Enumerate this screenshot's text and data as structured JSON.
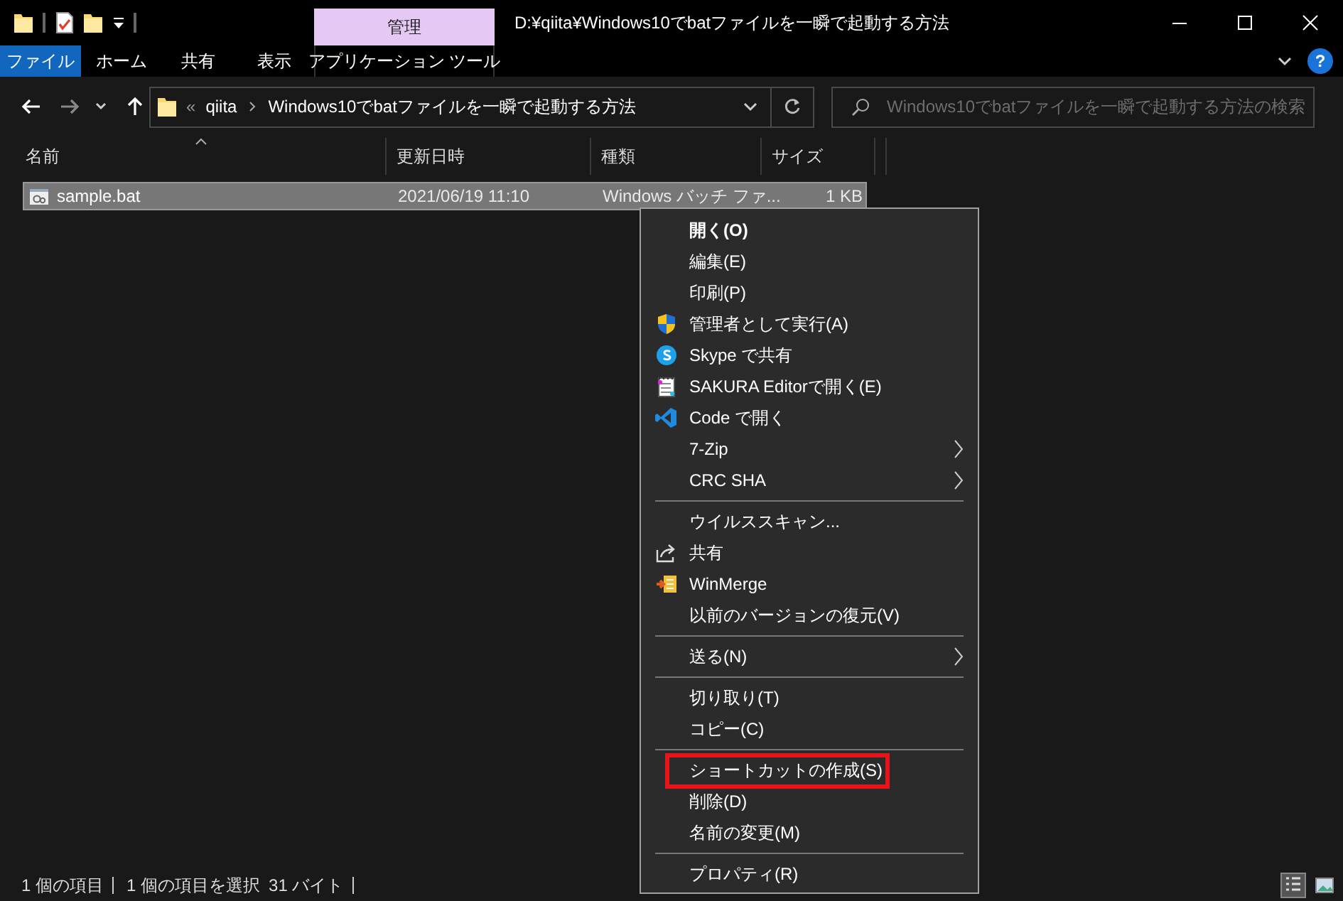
{
  "window": {
    "title": "D:¥qiita¥Windows10でbatファイルを一瞬で起動する方法"
  },
  "ribbon": {
    "tabs": [
      {
        "label": "ファイル",
        "kind": "file",
        "selected": false
      },
      {
        "label": "ホーム",
        "kind": "tab",
        "selected": false
      },
      {
        "label": "共有",
        "kind": "tab",
        "selected": false
      },
      {
        "label": "表示",
        "kind": "tab",
        "selected": false
      }
    ],
    "contextual": {
      "header": "管理",
      "tab": "アプリケーション ツール"
    },
    "help": "?"
  },
  "address": {
    "overflow": "«",
    "crumbs": [
      "qiita",
      "Windows10でbatファイルを一瞬で起動する方法"
    ]
  },
  "search": {
    "placeholder": "Windows10でbatファイルを一瞬で起動する方法の検索"
  },
  "table": {
    "columns": [
      "名前",
      "更新日時",
      "種類",
      "サイズ"
    ],
    "rows": [
      {
        "cells": [
          "sample.bat",
          "2021/06/19 11:10",
          "Windows バッチ ファ...",
          "1 KB"
        ],
        "selected": true
      }
    ]
  },
  "context_menu": {
    "items": [
      {
        "kind": "plain",
        "label": "開く(O)",
        "default": true,
        "submenu": false,
        "highlighted": false
      },
      {
        "kind": "plain",
        "label": "編集(E)",
        "default": false,
        "submenu": false,
        "highlighted": false
      },
      {
        "kind": "plain",
        "label": "印刷(P)",
        "default": false,
        "submenu": false,
        "highlighted": false
      },
      {
        "kind": "shield",
        "label": "管理者として実行(A)",
        "default": false,
        "submenu": false,
        "highlighted": false
      },
      {
        "kind": "skype",
        "label": "Skype で共有",
        "default": false,
        "submenu": false,
        "highlighted": false
      },
      {
        "kind": "notepad",
        "label": "SAKURA Editorで開く(E)",
        "default": false,
        "submenu": false,
        "highlighted": false
      },
      {
        "kind": "code",
        "label": "Code で開く",
        "default": false,
        "submenu": false,
        "highlighted": false
      },
      {
        "kind": "plain",
        "label": "7-Zip",
        "default": false,
        "submenu": true,
        "highlighted": false
      },
      {
        "kind": "plain",
        "label": "CRC SHA",
        "default": false,
        "submenu": true,
        "highlighted": false
      },
      {
        "kind": "separator"
      },
      {
        "kind": "plain",
        "label": "ウイルススキャン...",
        "default": false,
        "submenu": false,
        "highlighted": false
      },
      {
        "kind": "share",
        "label": "共有",
        "default": false,
        "submenu": false,
        "highlighted": false
      },
      {
        "kind": "compare",
        "label": "WinMerge",
        "default": false,
        "submenu": false,
        "highlighted": false
      },
      {
        "kind": "plain",
        "label": "以前のバージョンの復元(V)",
        "default": false,
        "submenu": false,
        "highlighted": false
      },
      {
        "kind": "separator"
      },
      {
        "kind": "plain",
        "label": "送る(N)",
        "default": false,
        "submenu": true,
        "highlighted": false
      },
      {
        "kind": "separator"
      },
      {
        "kind": "plain",
        "label": "切り取り(T)",
        "default": false,
        "submenu": false,
        "highlighted": false
      },
      {
        "kind": "plain",
        "label": "コピー(C)",
        "default": false,
        "submenu": false,
        "highlighted": false
      },
      {
        "kind": "separator"
      },
      {
        "kind": "plain",
        "label": "ショートカットの作成(S)",
        "default": false,
        "submenu": false,
        "highlighted": true
      },
      {
        "kind": "plain",
        "label": "削除(D)",
        "default": false,
        "submenu": false,
        "highlighted": false
      },
      {
        "kind": "plain",
        "label": "名前の変更(M)",
        "default": false,
        "submenu": false,
        "highlighted": false
      },
      {
        "kind": "separator"
      },
      {
        "kind": "plain",
        "label": "プロパティ(R)",
        "default": false,
        "submenu": false,
        "highlighted": false
      }
    ]
  },
  "status_bar": {
    "items": [
      {
        "text": "1 個の項目",
        "divider": true
      },
      {
        "text": "1 個の項目を選択",
        "divider": false
      },
      {
        "text": "31 バイト",
        "divider": true
      }
    ],
    "views": [
      {
        "kind": "details",
        "selected": true
      },
      {
        "kind": "thumbnails",
        "selected": false
      }
    ]
  }
}
